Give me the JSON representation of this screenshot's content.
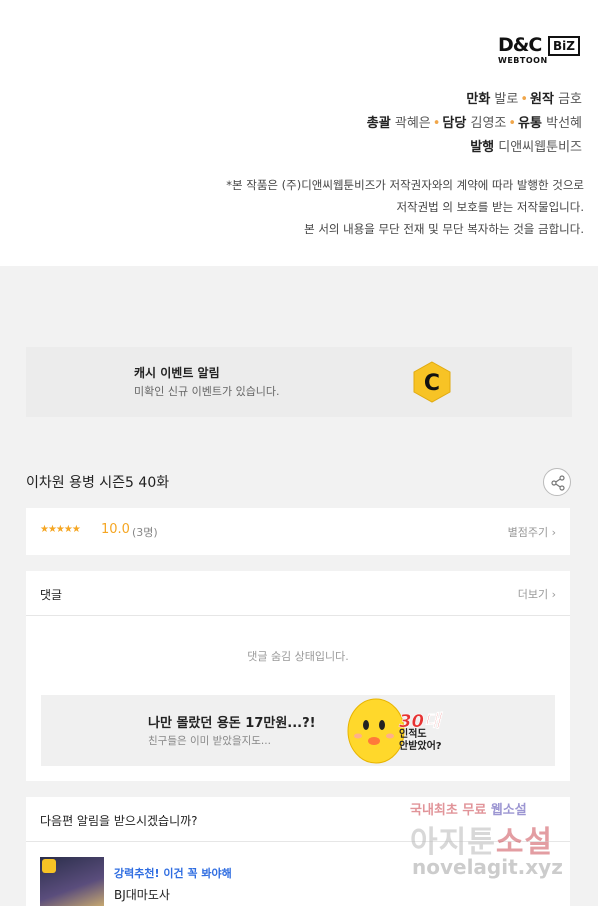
{
  "credits": {
    "logo_main": "D&C",
    "logo_biz": "BiZ",
    "logo_sub": "WEBTOON",
    "manhwa_label": "만화",
    "manhwa_value": "발로",
    "original_label": "원작",
    "original_value": "금호",
    "supervisor_label": "총괄",
    "supervisor_value": "곽혜은",
    "manager_label": "담당",
    "manager_value": "김영조",
    "distribution_label": "유통",
    "distribution_value": "박선혜",
    "publisher_label": "발행",
    "publisher_value": "디앤씨웹툰비즈",
    "notice_1": "*본 작품은 (주)디앤씨웹툰비즈가 저작권자와의 계약에 따라 발행한 것으로",
    "notice_2": "저작권법 의 보호를 받는 저작물입니다.",
    "notice_3": "본 서의 내용을 무단 전재 및 무단 복자하는 것을 금합니다."
  },
  "cash_banner": {
    "title": "캐시 이벤트 알림",
    "subtitle": "미확인 신규 이벤트가 있습니다.",
    "icon_letter": "C",
    "icon": "cash-coin-icon",
    "accent": "#f7c325"
  },
  "episode": {
    "title": "이차원 용병 시즌5 40화",
    "share_icon": "share-icon"
  },
  "rating": {
    "stars": "★★★★★",
    "score": "10.0",
    "count": "(3명)",
    "rate_link": "별점주기 ›",
    "star_color": "#f5a623"
  },
  "comments": {
    "title": "댓글",
    "more_link": "더보기 ›",
    "hidden_message": "댓글 숨김 상태입니다."
  },
  "ad": {
    "title": "나만 몰랐던 용돈 17만원...?!",
    "subtitle": "친구들은 이미 받았을지도...",
    "badge": "30대",
    "question_1": "인적도",
    "question_2": "안받았어?"
  },
  "next_alert": {
    "title": "다음편 알림을 받으시겠습니까?",
    "promo": "강력추천! 이건 꼭 봐야해",
    "recommended_title": "BJ대마도사"
  },
  "watermark": {
    "line1a": "국내최초 무료 ",
    "line1b": "웹소설",
    "line2a": "아지툰",
    "line2b": "소설",
    "line3": "novelagit.xyz"
  }
}
